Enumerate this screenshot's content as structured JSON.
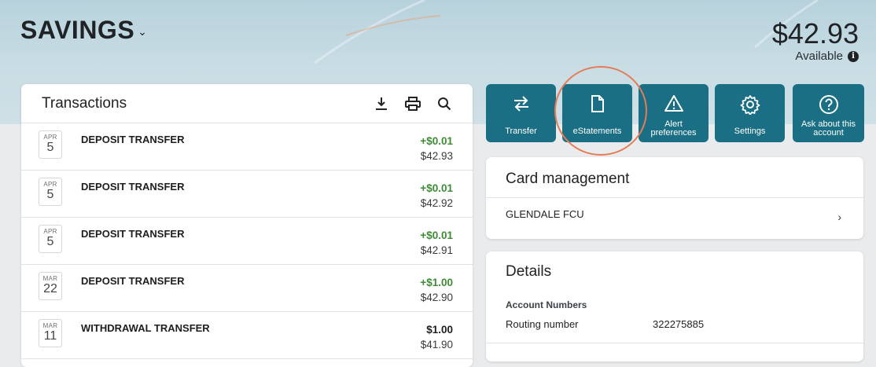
{
  "account": {
    "title": "SAVINGS",
    "balance": "$42.93",
    "available_label": "Available"
  },
  "transactions": {
    "title": "Transactions",
    "rows": [
      {
        "month": "APR",
        "day": "5",
        "description": "DEPOSIT TRANSFER",
        "amount": "+$0.01",
        "balance": "$42.93",
        "positive": true
      },
      {
        "month": "APR",
        "day": "5",
        "description": "DEPOSIT TRANSFER",
        "amount": "+$0.01",
        "balance": "$42.92",
        "positive": true
      },
      {
        "month": "APR",
        "day": "5",
        "description": "DEPOSIT TRANSFER",
        "amount": "+$0.01",
        "balance": "$42.91",
        "positive": true
      },
      {
        "month": "MAR",
        "day": "22",
        "description": "DEPOSIT TRANSFER",
        "amount": "+$1.00",
        "balance": "$42.90",
        "positive": true
      },
      {
        "month": "MAR",
        "day": "11",
        "description": "WITHDRAWAL TRANSFER",
        "amount": "$1.00",
        "balance": "$41.90",
        "positive": false
      }
    ]
  },
  "actions": [
    {
      "label": "Transfer",
      "icon": "transfer-icon"
    },
    {
      "label": "eStatements",
      "icon": "document-icon"
    },
    {
      "label": "Alert\npreferences",
      "label_line1": "Alert",
      "label_line2": "preferences",
      "icon": "alert-icon"
    },
    {
      "label": "Settings",
      "icon": "gear-icon"
    },
    {
      "label": "Ask about this account",
      "label_line1": "Ask about this",
      "label_line2": "account",
      "icon": "question-icon"
    }
  ],
  "card_management": {
    "title": "Card management",
    "item": "GLENDALE FCU"
  },
  "details": {
    "title": "Details",
    "section_label": "Account Numbers",
    "routing_label": "Routing number",
    "routing_value": "322275885"
  },
  "colors": {
    "action_bg": "#1a6f84",
    "positive_amount": "#3d8b34",
    "highlight_ring": "#e57c58"
  }
}
